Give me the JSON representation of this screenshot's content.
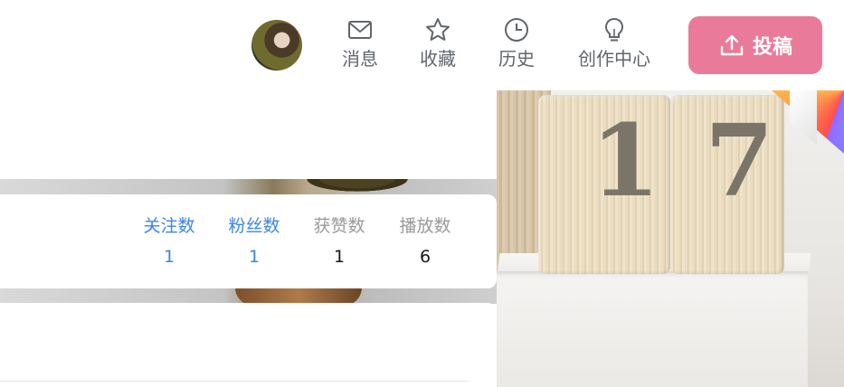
{
  "nav": {
    "items": [
      {
        "label": "消息",
        "icon": "mail-icon"
      },
      {
        "label": "收藏",
        "icon": "star-icon"
      },
      {
        "label": "历史",
        "icon": "clock-icon"
      },
      {
        "label": "创作中心",
        "icon": "lightbulb-icon"
      }
    ],
    "upload_label": "投稿",
    "upload_icon": "upload-icon"
  },
  "stats": [
    {
      "label": "关注数",
      "value": "1"
    },
    {
      "label": "粉丝数",
      "value": "1"
    },
    {
      "label": "获赞数",
      "value": "1"
    },
    {
      "label": "播放数",
      "value": "6"
    }
  ],
  "banner_photo": {
    "calendar_digits": [
      "1",
      "7"
    ]
  },
  "colors": {
    "accent_pink": "#ea7a99",
    "link_blue": "#3a85e6",
    "muted_gray": "#9a9a9a",
    "nav_gray": "#61666d"
  }
}
